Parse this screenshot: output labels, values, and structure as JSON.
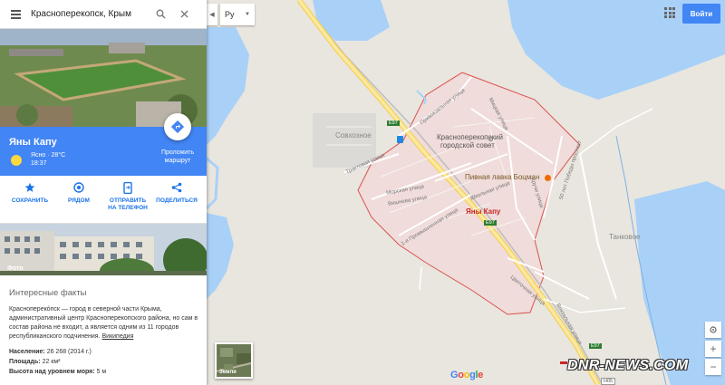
{
  "search": {
    "value": "Красноперекопск, Крым"
  },
  "place": {
    "name": "Яны Капу",
    "weather_line1": "Ясно · 28°C",
    "weather_line2": "18:37",
    "route_label_1": "Проложить",
    "route_label_2": "маршрут"
  },
  "actions": [
    {
      "label1": "СОХРАНИТЬ",
      "label2": "",
      "icon": "star-icon"
    },
    {
      "label1": "РЯДОМ",
      "label2": "",
      "icon": "nearby-icon"
    },
    {
      "label1": "ОТПРАВИТЬ",
      "label2": "НА ТЕЛЕФОН",
      "icon": "send-to-phone-icon"
    },
    {
      "label1": "ПОДЕЛИТЬСЯ",
      "label2": "",
      "icon": "share-icon"
    }
  ],
  "hero_photo_label": "",
  "photo_label": "Фото",
  "facts": {
    "heading": "Интересные факты",
    "text": "Красноперекóпск — город в северной части Крыма, административный центр Красноперекопского района, но сам в состав района не входит, а является одним из 11 городов республиканского подчинения.",
    "link": "Википедия",
    "population_label": "Население:",
    "population_value": "26 268 (2014 г.)",
    "area_label": "Площадь:",
    "area_value": "22 км²",
    "elevation_label": "Высота над уровнем моря:",
    "elevation_value": "5 м"
  },
  "controls": {
    "lang": "Ру",
    "signin": "Войти",
    "earth": "Земля"
  },
  "map_labels": {
    "city": "Яны Капу",
    "council_1": "Красноперекопский",
    "council_2": "городской совет",
    "pub": "Пивная лавка Боцман",
    "sovkhoznoe": "Совхозное",
    "tankovoe": "Танковое",
    "road_e97_a": "E97",
    "road_e97_b": "E97",
    "road_e97_c": "E97",
    "road_h05": "H05",
    "st_privokzalnaya": "Привокзальная улица",
    "st_mitskaya": "Мицкая улица",
    "st_tsentralnaya": "Трактовая улица",
    "st_morskaya": "Морская улица",
    "st_vishneva": "Вишнева улица",
    "st_promyshlennaya": "1-я Промышленная улица",
    "st_shkolnaya": "Школьная улица",
    "st_krasnaya": "Улица Залива",
    "st_kuzmicha": "Кручи улица",
    "st_50let": "50 лет Победы проспект",
    "st_tsvetochnaya": "Цветочная улица",
    "st_vokzalnaya": "Вокзальная улица"
  },
  "google_logo": "Google",
  "watermark": "DNR-NEWS.COM",
  "colors": {
    "accent": "#4285f4",
    "boundary": "#d9534f",
    "water": "#a9d1f8",
    "road": "#f7e38a"
  }
}
